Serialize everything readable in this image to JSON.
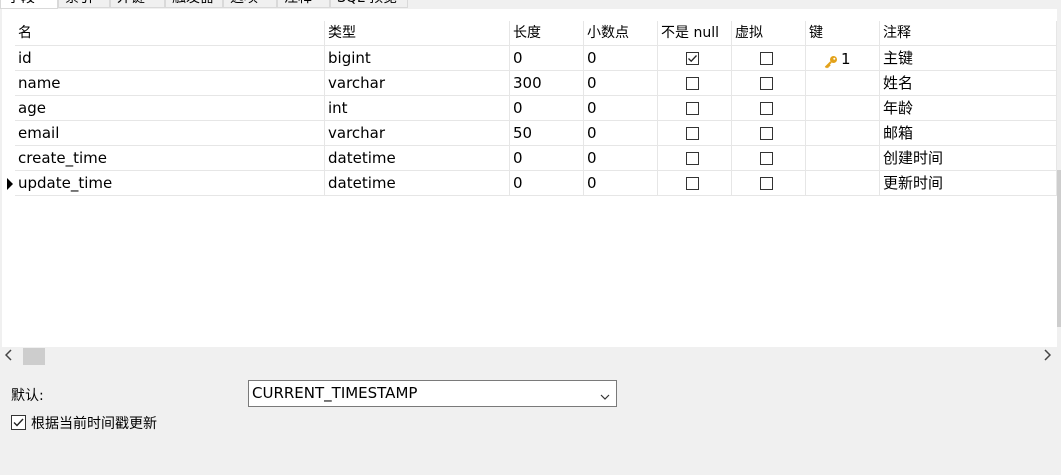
{
  "tabs": [
    "字段",
    "索引",
    "外键",
    "触发器",
    "选项",
    "注释",
    "SQL 预览"
  ],
  "columns": [
    "名",
    "类型",
    "长度",
    "小数点",
    "不是 null",
    "虚拟",
    "键",
    "注释"
  ],
  "rows": [
    {
      "name": "id",
      "type": "bigint",
      "length": "0",
      "decimals": "0",
      "not_null": true,
      "virtual": false,
      "key": "1",
      "comment": "主键",
      "current": false
    },
    {
      "name": "name",
      "type": "varchar",
      "length": "300",
      "decimals": "0",
      "not_null": false,
      "virtual": false,
      "key": "",
      "comment": "姓名",
      "current": false
    },
    {
      "name": "age",
      "type": "int",
      "length": "0",
      "decimals": "0",
      "not_null": false,
      "virtual": false,
      "key": "",
      "comment": "年龄",
      "current": false
    },
    {
      "name": "email",
      "type": "varchar",
      "length": "50",
      "decimals": "0",
      "not_null": false,
      "virtual": false,
      "key": "",
      "comment": "邮箱",
      "current": false
    },
    {
      "name": "create_time",
      "type": "datetime",
      "length": "0",
      "decimals": "0",
      "not_null": false,
      "virtual": false,
      "key": "",
      "comment": "创建时间",
      "current": false
    },
    {
      "name": "update_time",
      "type": "datetime",
      "length": "0",
      "decimals": "0",
      "not_null": false,
      "virtual": false,
      "key": "",
      "comment": "更新时间",
      "current": true
    }
  ],
  "icons": {
    "primary_key": "key-icon",
    "scroll_left": "chevron-left-icon",
    "scroll_right": "chevron-right-icon",
    "dropdown": "chevron-down-icon",
    "row_indicator": "row-pointer-icon"
  },
  "colors": {
    "key": "#e3a21a"
  },
  "properties": {
    "default_label": "默认:",
    "default_value": "CURRENT_TIMESTAMP",
    "on_update_label": "根据当前时间戳更新",
    "on_update_checked": true
  }
}
